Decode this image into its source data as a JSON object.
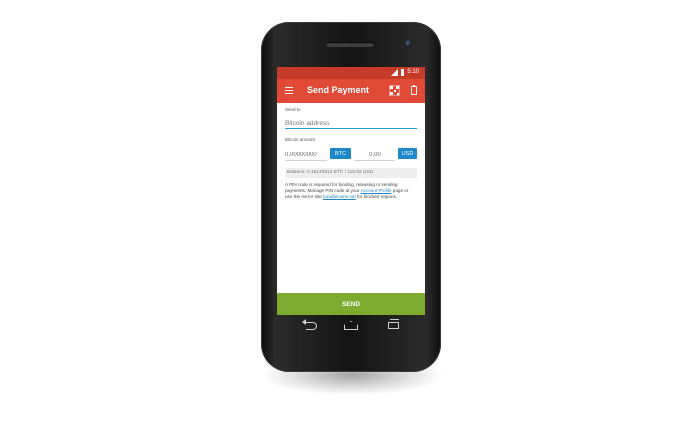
{
  "status_bar": {
    "time": "5:10"
  },
  "app_bar": {
    "title": "Send Payment",
    "menu_icon": "hamburger-menu-icon",
    "qr_icon": "qr-code-icon",
    "clipboard_icon": "clipboard-icon"
  },
  "form": {
    "send_to_label": "Send to",
    "address_placeholder": "Bitcoin address",
    "amount_label": "Bitcoin amount",
    "btc_value": "0.00000000",
    "btc_button": "BTC",
    "usd_value": "0.00",
    "usd_button": "USD",
    "balance": "Balance: 0.16140513 BTC / 119.02 USD"
  },
  "info": {
    "text_1": "A PIN code is required for funding, releasing or sending payments. Manage PIN code at your ",
    "link_1": "Account Profile",
    "text_2": " page or use the mirror site ",
    "link_2": "localbitcoins.net",
    "text_3": " for blocked regions."
  },
  "send_button": "SEND",
  "colors": {
    "status_bar": "#c63a2a",
    "app_bar": "#e04a36",
    "accent": "#1e88c9",
    "send": "#7cab30"
  }
}
